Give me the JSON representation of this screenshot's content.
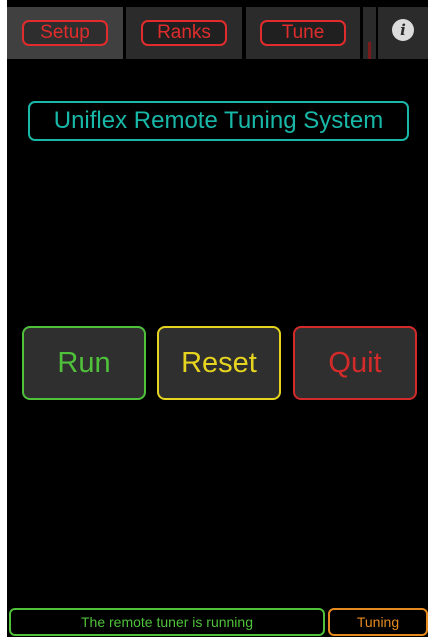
{
  "tabs": [
    {
      "label": "Setup",
      "selected": true
    },
    {
      "label": "Ranks",
      "selected": false
    },
    {
      "label": "Tune",
      "selected": false
    }
  ],
  "info_icon": {
    "glyph": "i",
    "name": "info-icon"
  },
  "title": "Uniflex Remote Tuning System",
  "buttons": {
    "run": "Run",
    "reset": "Reset",
    "quit": "Quit"
  },
  "status": {
    "message": "The remote tuner is running",
    "mode": "Tuning"
  },
  "colors": {
    "tab_accent": "#e02c2c",
    "title": "#18b8a8",
    "run": "#4fc13a",
    "reset": "#e6d420",
    "quit": "#d42a2a",
    "status": "#4fc13a",
    "mode": "#e58a1f"
  }
}
